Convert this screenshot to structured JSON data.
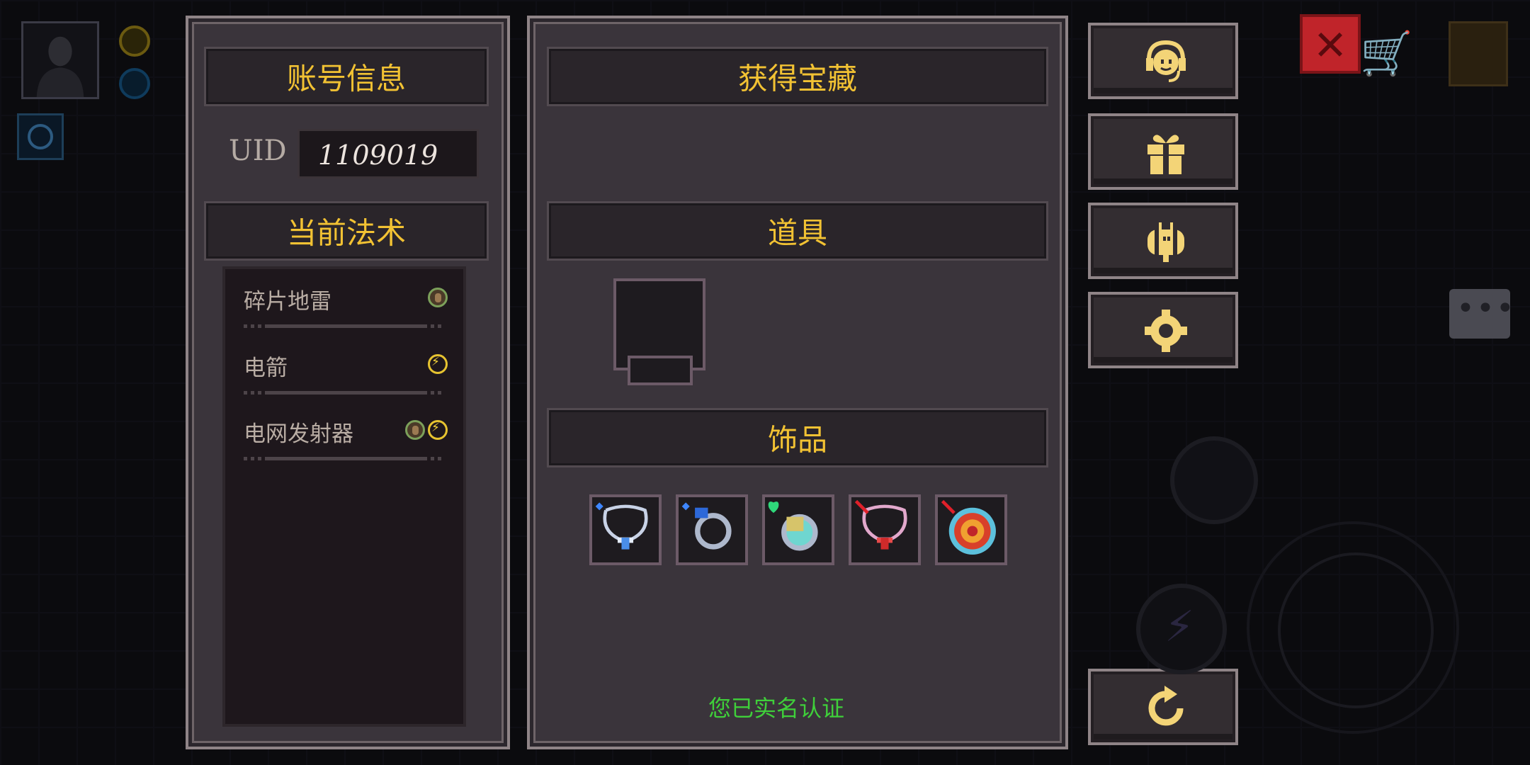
{
  "account_panel": {
    "title": "账号信息",
    "uid_label": "UID",
    "uid_value": "1109019",
    "spells_title": "当前法术",
    "spells": [
      {
        "name": "碎片地雷",
        "elements": [
          "earth"
        ]
      },
      {
        "name": "电箭",
        "elements": [
          "electric"
        ]
      },
      {
        "name": "电网发射器",
        "elements": [
          "earth",
          "electric"
        ]
      }
    ]
  },
  "treasure_panel": {
    "title": "获得宝藏",
    "props_title": "道具",
    "accessories_title": "饰品",
    "accessories": [
      "ice-necklace-icon",
      "sapphire-ring-icon",
      "emerald-ring-icon",
      "ruby-necklace-icon",
      "fire-target-icon"
    ],
    "verified_text": "您已实名认证"
  },
  "side_buttons": [
    "support-headset-icon",
    "gift-icon",
    "bee-icon",
    "settings-gear-icon",
    "restart-icon"
  ],
  "colors": {
    "title_gold": "#f2c233",
    "verified_green": "#3fcf3a",
    "panel_bg": "#3a343b",
    "close_red": "#c0242a"
  }
}
